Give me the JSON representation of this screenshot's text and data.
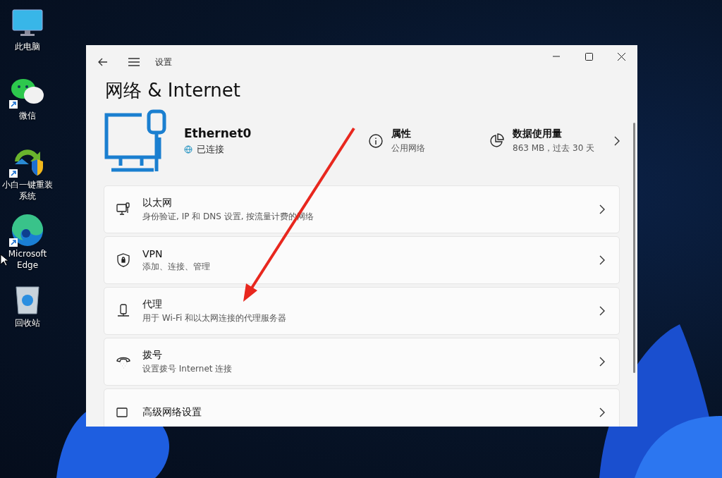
{
  "desktop_icons": [
    {
      "label": "此电脑",
      "kind": "pc",
      "shortcut": false
    },
    {
      "label": "微信",
      "kind": "chat",
      "shortcut": true
    },
    {
      "label": "小白一键重装系统",
      "kind": "installer",
      "shortcut": true
    },
    {
      "label": "Microsoft Edge",
      "kind": "browser",
      "shortcut": true
    },
    {
      "label": "回收站",
      "kind": "bin",
      "shortcut": false
    }
  ],
  "window": {
    "title": "设置",
    "page_title": "网络 & Internet",
    "connection": {
      "name": "Ethernet0",
      "status": "已连接"
    },
    "properties": {
      "label": "属性",
      "value": "公用网络"
    },
    "data_usage": {
      "label": "数据使用量",
      "value": "863 MB，过去 30 天"
    },
    "items": [
      {
        "kind": "ethernet",
        "title": "以太网",
        "description": "身份验证, IP 和 DNS 设置, 按流量计费的网络"
      },
      {
        "kind": "vpn",
        "title": "VPN",
        "description": "添加、连接、管理"
      },
      {
        "kind": "proxy",
        "title": "代理",
        "description": "用于 Wi-Fi 和以太网连接的代理服务器"
      },
      {
        "kind": "dialup",
        "title": "拨号",
        "description": "设置拨号 Internet 连接"
      },
      {
        "kind": "advanced",
        "title": "高级网络设置"
      }
    ]
  }
}
